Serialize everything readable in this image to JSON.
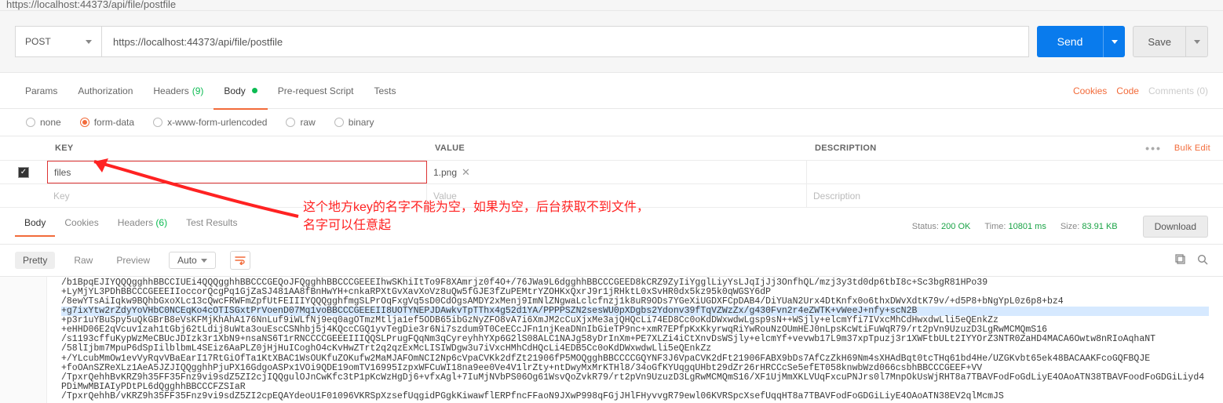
{
  "top_url": "https://localhost:44373/api/file/postfile",
  "request": {
    "method": "POST",
    "url": "https://localhost:44373/api/file/postfile",
    "send_label": "Send",
    "save_label": "Save"
  },
  "req_tabs": {
    "params": "Params",
    "authorization": "Authorization",
    "headers": "Headers",
    "headers_count": "(9)",
    "body": "Body",
    "prerequest": "Pre-request Script",
    "tests": "Tests"
  },
  "req_links": {
    "cookies": "Cookies",
    "code": "Code",
    "comments": "Comments (0)"
  },
  "body_types": {
    "none": "none",
    "form_data": "form-data",
    "urlencoded": "x-www-form-urlencoded",
    "raw": "raw",
    "binary": "binary"
  },
  "kv_headers": {
    "key": "KEY",
    "value": "VALUE",
    "description": "DESCRIPTION",
    "bulk_edit": "Bulk Edit"
  },
  "kv_rows": [
    {
      "checked": true,
      "key": "files",
      "value_file": "1.png",
      "description": ""
    }
  ],
  "kv_placeholder": {
    "key": "Key",
    "value": "Value",
    "description": "Description"
  },
  "annotation": {
    "line1": "这个地方key的名字不能为空，如果为空，后台获取不到文件，",
    "line2": "名字可以任意起"
  },
  "resp_tabs": {
    "body": "Body",
    "cookies": "Cookies",
    "headers": "Headers",
    "headers_count": "(6)",
    "test_results": "Test Results"
  },
  "resp_meta": {
    "status_label": "Status:",
    "status_value": "200 OK",
    "time_label": "Time:",
    "time_value": "10801 ms",
    "size_label": "Size:",
    "size_value": "83.91 KB",
    "download": "Download"
  },
  "resp_toolbar": {
    "pretty": "Pretty",
    "raw": "Raw",
    "preview": "Preview",
    "auto": "Auto"
  },
  "response_lines": [
    "/b1BpqEJIYQQQgghhBBCCIUEi4QQQgghhBBCCCGEQoJFQgghhBBCCCGEEEIhwSKhiItTo9F8XAmrjz0f4O+/76JWa9L6dgghhBBCCCGEED8kCRZ9ZyIiYgglLiyYsLJqIjJj3OnfhQL/mzj3y3td0dp6tbI8c+Sc3bgR81HPo39",
    "+LyMjYL3PDhBBCCCGEEEIIoccorQcgPq1GjZaSJ481AA8fBnHwYH+cnkaRPXtGvXavXoVz8uQw5fGJE3fZuPEMtrYZOHKxQxrJ9r1jRHktL0xSvHR0dx5kz95k0qWGSY6dP",
    "/8ewYTsAiIqkw9BQhbGxoXLc13cQwcFRWFmZpfUtFEIIIYQQQgghfmgSLPrOqFxgVq5sD0CdOgsAMDY2xMenj9ImNlZNgwaLclcfnzj1k8uR9ODs7YGeXiUGDXFCpDAB4/DiYUaN2Urx4DtKnfx0o6thxDWvXdtK79v/+d5P8+bNgYpL0z6p8+bz4",
    "+g7ixYtw2rZdyYoVHbC0NCEqKo4cOTISGxtPrVoenD07Mq1voBBCCCGEEEII8UOTYNEPJDAwkvTpTThx4g52d1YA/PPPPSZN2sesWU0pXDgbs2Ydonv39fTqVZWzZx/g430Fvn2r4eZWTK+vWeeJ+nfy+scN2B",
    "+p3r1uYBuSpy5uQkGBrB8eVsKFMjKhAhA176NnLuf9iWLfNj9eq0agOTmzMtlja1ef5ODB65ibGzNyZFO8vA7i6XmJM2cCuXjxMe3ajQHQcLi74ED8Cc0oKdDWxwdwLgsp9sN++WSjly+elcmYfi7IVxcMhCdHwxdwLli5eQEnkZz",
    "+eHHD06E2qVcuv1zah1tGbj62tLdij8uWta3ouEscCSNhbj5j4KQccCGQ1yvTegDie3r6Ni7szdum9T0CeECcJFn1njKeaDNnIbGieTP9nc+xmR7EPfpKxKkyrwqRiYwRouNzOUmHEJ0nLpsKcWtiFuWqR79/rt2pVn9UzuzD3LgRwMCMQmS16",
    "/s1193cffuKypWzMeCBUcJDIzk3r1XbN9+nsaNS6T1rRNCCCCGEEEIIIQQSLPrugFQqNm3qCyreyhhYXp6G2lS08ALC1NAJg58yDrInXm+PE7XLZi4iCtXnvDsWSjly+elcmYf+vevwb17L9m37xpTpuzj3r1XWFtbULt2IYYOrZ3NTR0ZaHD4MACA6Owtw8nRIoAqhaNT",
    "/58lIjbm7MpuP6dSpIilblbmL4SEiz6AaPLZ0jHjHuICoghO4cKvHwZTrt2q2qzExMcLISIWDgw3u7iVxcHMhCdHQcLi4EDB5Cc0oKdDWxwdwLli5eQEnkZz",
    "+/YLcubMmOw1evVyRqvVBaEarI17RtGiOfTa1KtXBAC1WsOUKfuZOKufw2MaMJAFOmNCI2Np6cVpaCVKk2dfZt21906fP5MOQgghBBCCCCGQYNF3J6VpaCVK2dFt21906FABX9bDs7AfCzZkH69Nm4sXHAdBqt0tcTHq61bd4He/UZGKvbt65ek48BACAAKFcoGQFBQJE",
    "+foOAnSZReXLz1AeA5JZJIQQgghhPjuPX16GdgoASPx1VOi9QDE19omTV16995IzpxWFCuWI18na9ee0Ve4V1lrZty+ntDwyMxMrKTHl8/34oGfKYUqgqUHbt29dZr26rHRCCcSe5efET058knwbWzd066csbhBBCCCGEEF+VV",
    "/TpxrQehhBvKRZ9h35FF35Fnz9vi9sdZ5ZI2cjIQQgulOJnCwKfc3tP1pKcWzHgDj6+vfxAgl+7IuMjNVbPS06Og61WsvQoZvkR79/rt2pVn9UzuzD3LgRwMCMQmS16/XF1UjMmXKLVUqFxcuPNJrs0l7MnpOkUsWjRHT8a7TBAVFodFoGdLiyE4OAoATN38TBAVFoodFoGDGiLiyd4PDiMwMBIAIyPDtPL6dQgghhBBCCCFZSIaR",
    "/TpxrQehhB/vKRZ9h35FF35Fnz9vi9sdZ5ZI2cpEQAYdeoU1F01096VKRSpXzsefUqgidPGgkKiwawflERPfncFFaoN9JXwP998qFGjJHlFHyvvgR79ewl06KVRSpcXsefUqqHT8a7TBAVFodFoGDGiLiyE4OAoATN38EV2qlMcmJS"
  ],
  "highlight_index": 3
}
